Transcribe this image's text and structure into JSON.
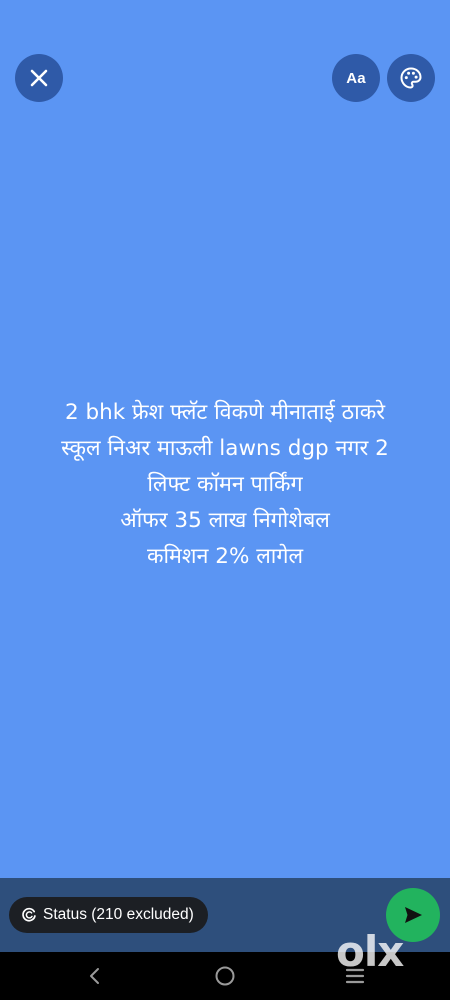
{
  "theme": {
    "background": "#5b95f3",
    "button_bg": "#2f5aa8",
    "bottom_bar": "#2e4f7c",
    "send_green": "#22b35e"
  },
  "toolbar": {
    "close_icon": "close-icon",
    "font_label": "Aa",
    "palette_icon": "palette-icon"
  },
  "status": {
    "lines": [
      "2 bhk फ्रेश फ्लॅट विकणे मीनाताई ठाकरे",
      "स्कूल निअर माऊली lawns dgp नगर 2",
      "लिफ्ट कॉमन पार्किंग",
      "ऑफर 35 लाख निगोशेबल",
      "कमिशन 2% लागेल"
    ]
  },
  "bottom": {
    "privacy_label": "Status (210 excluded)",
    "privacy_icon": "status-icon",
    "send_icon": "send-icon"
  },
  "watermark": {
    "text": "olx"
  },
  "nav": {
    "back_icon": "back-icon",
    "home_icon": "home-icon",
    "recents_icon": "recents-icon"
  }
}
